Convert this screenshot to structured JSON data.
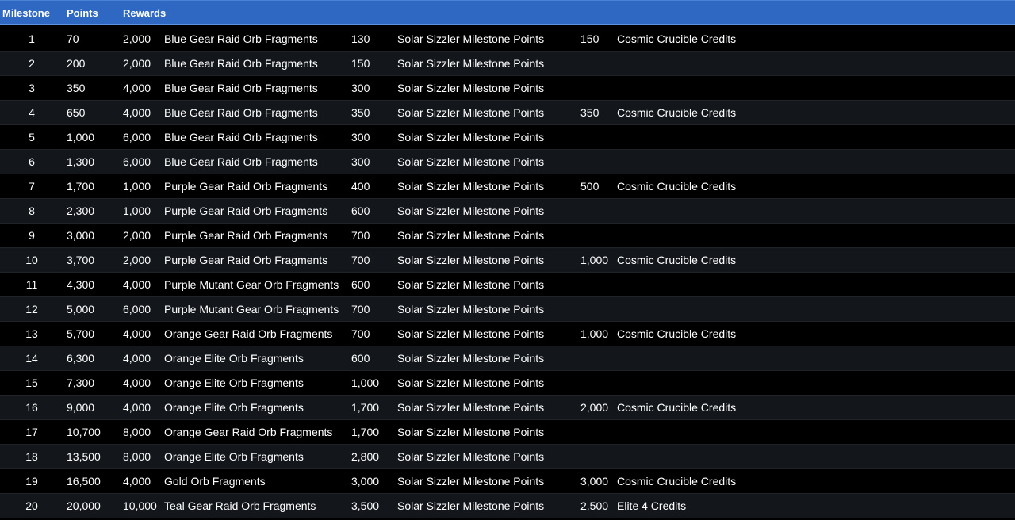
{
  "header": {
    "milestone": "Milestone",
    "points": "Points",
    "rewards": "Rewards"
  },
  "rows": [
    {
      "milestone": "1",
      "points": "70",
      "r1_amount": "2,000",
      "r1_name": "Blue Gear Raid Orb Fragments",
      "r2_amount": "130",
      "r2_name": "Solar Sizzler Milestone Points",
      "r3_amount": "150",
      "r3_name": "Cosmic Crucible Credits"
    },
    {
      "milestone": "2",
      "points": "200",
      "r1_amount": "2,000",
      "r1_name": "Blue Gear Raid Orb Fragments",
      "r2_amount": "150",
      "r2_name": "Solar Sizzler Milestone Points",
      "r3_amount": "",
      "r3_name": ""
    },
    {
      "milestone": "3",
      "points": "350",
      "r1_amount": "4,000",
      "r1_name": "Blue Gear Raid Orb Fragments",
      "r2_amount": "300",
      "r2_name": "Solar Sizzler Milestone Points",
      "r3_amount": "",
      "r3_name": ""
    },
    {
      "milestone": "4",
      "points": "650",
      "r1_amount": "4,000",
      "r1_name": "Blue Gear Raid Orb Fragments",
      "r2_amount": "350",
      "r2_name": "Solar Sizzler Milestone Points",
      "r3_amount": "350",
      "r3_name": "Cosmic Crucible Credits"
    },
    {
      "milestone": "5",
      "points": "1,000",
      "r1_amount": "6,000",
      "r1_name": "Blue Gear Raid Orb Fragments",
      "r2_amount": "300",
      "r2_name": "Solar Sizzler Milestone Points",
      "r3_amount": "",
      "r3_name": ""
    },
    {
      "milestone": "6",
      "points": "1,300",
      "r1_amount": "6,000",
      "r1_name": "Blue Gear Raid Orb Fragments",
      "r2_amount": "300",
      "r2_name": "Solar Sizzler Milestone Points",
      "r3_amount": "",
      "r3_name": ""
    },
    {
      "milestone": "7",
      "points": "1,700",
      "r1_amount": "1,000",
      "r1_name": "Purple Gear Raid Orb Fragments",
      "r2_amount": "400",
      "r2_name": "Solar Sizzler Milestone Points",
      "r3_amount": "500",
      "r3_name": "Cosmic Crucible Credits"
    },
    {
      "milestone": "8",
      "points": "2,300",
      "r1_amount": "1,000",
      "r1_name": "Purple Gear Raid Orb Fragments",
      "r2_amount": "600",
      "r2_name": "Solar Sizzler Milestone Points",
      "r3_amount": "",
      "r3_name": ""
    },
    {
      "milestone": "9",
      "points": "3,000",
      "r1_amount": "2,000",
      "r1_name": "Purple Gear Raid Orb Fragments",
      "r2_amount": "700",
      "r2_name": "Solar Sizzler Milestone Points",
      "r3_amount": "",
      "r3_name": ""
    },
    {
      "milestone": "10",
      "points": "3,700",
      "r1_amount": "2,000",
      "r1_name": "Purple Gear Raid Orb Fragments",
      "r2_amount": "700",
      "r2_name": "Solar Sizzler Milestone Points",
      "r3_amount": "1,000",
      "r3_name": "Cosmic Crucible Credits"
    },
    {
      "milestone": "11",
      "points": "4,300",
      "r1_amount": "4,000",
      "r1_name": "Purple Mutant Gear Orb Fragments",
      "r2_amount": "600",
      "r2_name": "Solar Sizzler Milestone Points",
      "r3_amount": "",
      "r3_name": ""
    },
    {
      "milestone": "12",
      "points": "5,000",
      "r1_amount": "6,000",
      "r1_name": "Purple Mutant Gear Orb Fragments",
      "r2_amount": "700",
      "r2_name": "Solar Sizzler Milestone Points",
      "r3_amount": "",
      "r3_name": ""
    },
    {
      "milestone": "13",
      "points": "5,700",
      "r1_amount": "4,000",
      "r1_name": "Orange Gear Raid Orb Fragments",
      "r2_amount": "700",
      "r2_name": "Solar Sizzler Milestone Points",
      "r3_amount": "1,000",
      "r3_name": "Cosmic Crucible Credits"
    },
    {
      "milestone": "14",
      "points": "6,300",
      "r1_amount": "4,000",
      "r1_name": "Orange Elite Orb Fragments",
      "r2_amount": "600",
      "r2_name": "Solar Sizzler Milestone Points",
      "r3_amount": "",
      "r3_name": ""
    },
    {
      "milestone": "15",
      "points": "7,300",
      "r1_amount": "4,000",
      "r1_name": "Orange Elite Orb Fragments",
      "r2_amount": "1,000",
      "r2_name": "Solar Sizzler Milestone Points",
      "r3_amount": "",
      "r3_name": ""
    },
    {
      "milestone": "16",
      "points": "9,000",
      "r1_amount": "4,000",
      "r1_name": "Orange Elite Orb Fragments",
      "r2_amount": "1,700",
      "r2_name": "Solar Sizzler Milestone Points",
      "r3_amount": "2,000",
      "r3_name": "Cosmic Crucible Credits"
    },
    {
      "milestone": "17",
      "points": "10,700",
      "r1_amount": "8,000",
      "r1_name": "Orange Gear Raid Orb Fragments",
      "r2_amount": "1,700",
      "r2_name": "Solar Sizzler Milestone Points",
      "r3_amount": "",
      "r3_name": ""
    },
    {
      "milestone": "18",
      "points": "13,500",
      "r1_amount": "8,000",
      "r1_name": "Orange Elite Orb Fragments",
      "r2_amount": "2,800",
      "r2_name": "Solar Sizzler Milestone Points",
      "r3_amount": "",
      "r3_name": ""
    },
    {
      "milestone": "19",
      "points": "16,500",
      "r1_amount": "4,000",
      "r1_name": "Gold Orb Fragments",
      "r2_amount": "3,000",
      "r2_name": "Solar Sizzler Milestone Points",
      "r3_amount": "3,000",
      "r3_name": "Cosmic Crucible Credits"
    },
    {
      "milestone": "20",
      "points": "20,000",
      "r1_amount": "10,000",
      "r1_name": "Teal Gear Raid Orb Fragments",
      "r2_amount": "3,500",
      "r2_name": "Solar Sizzler Milestone Points",
      "r3_amount": "2,500",
      "r3_name": "Elite 4 Credits"
    }
  ],
  "colors": {
    "header_bg": "#2f68c2",
    "row_dark": "#000000",
    "row_alt": "#13171c",
    "text": "#ffffff"
  }
}
